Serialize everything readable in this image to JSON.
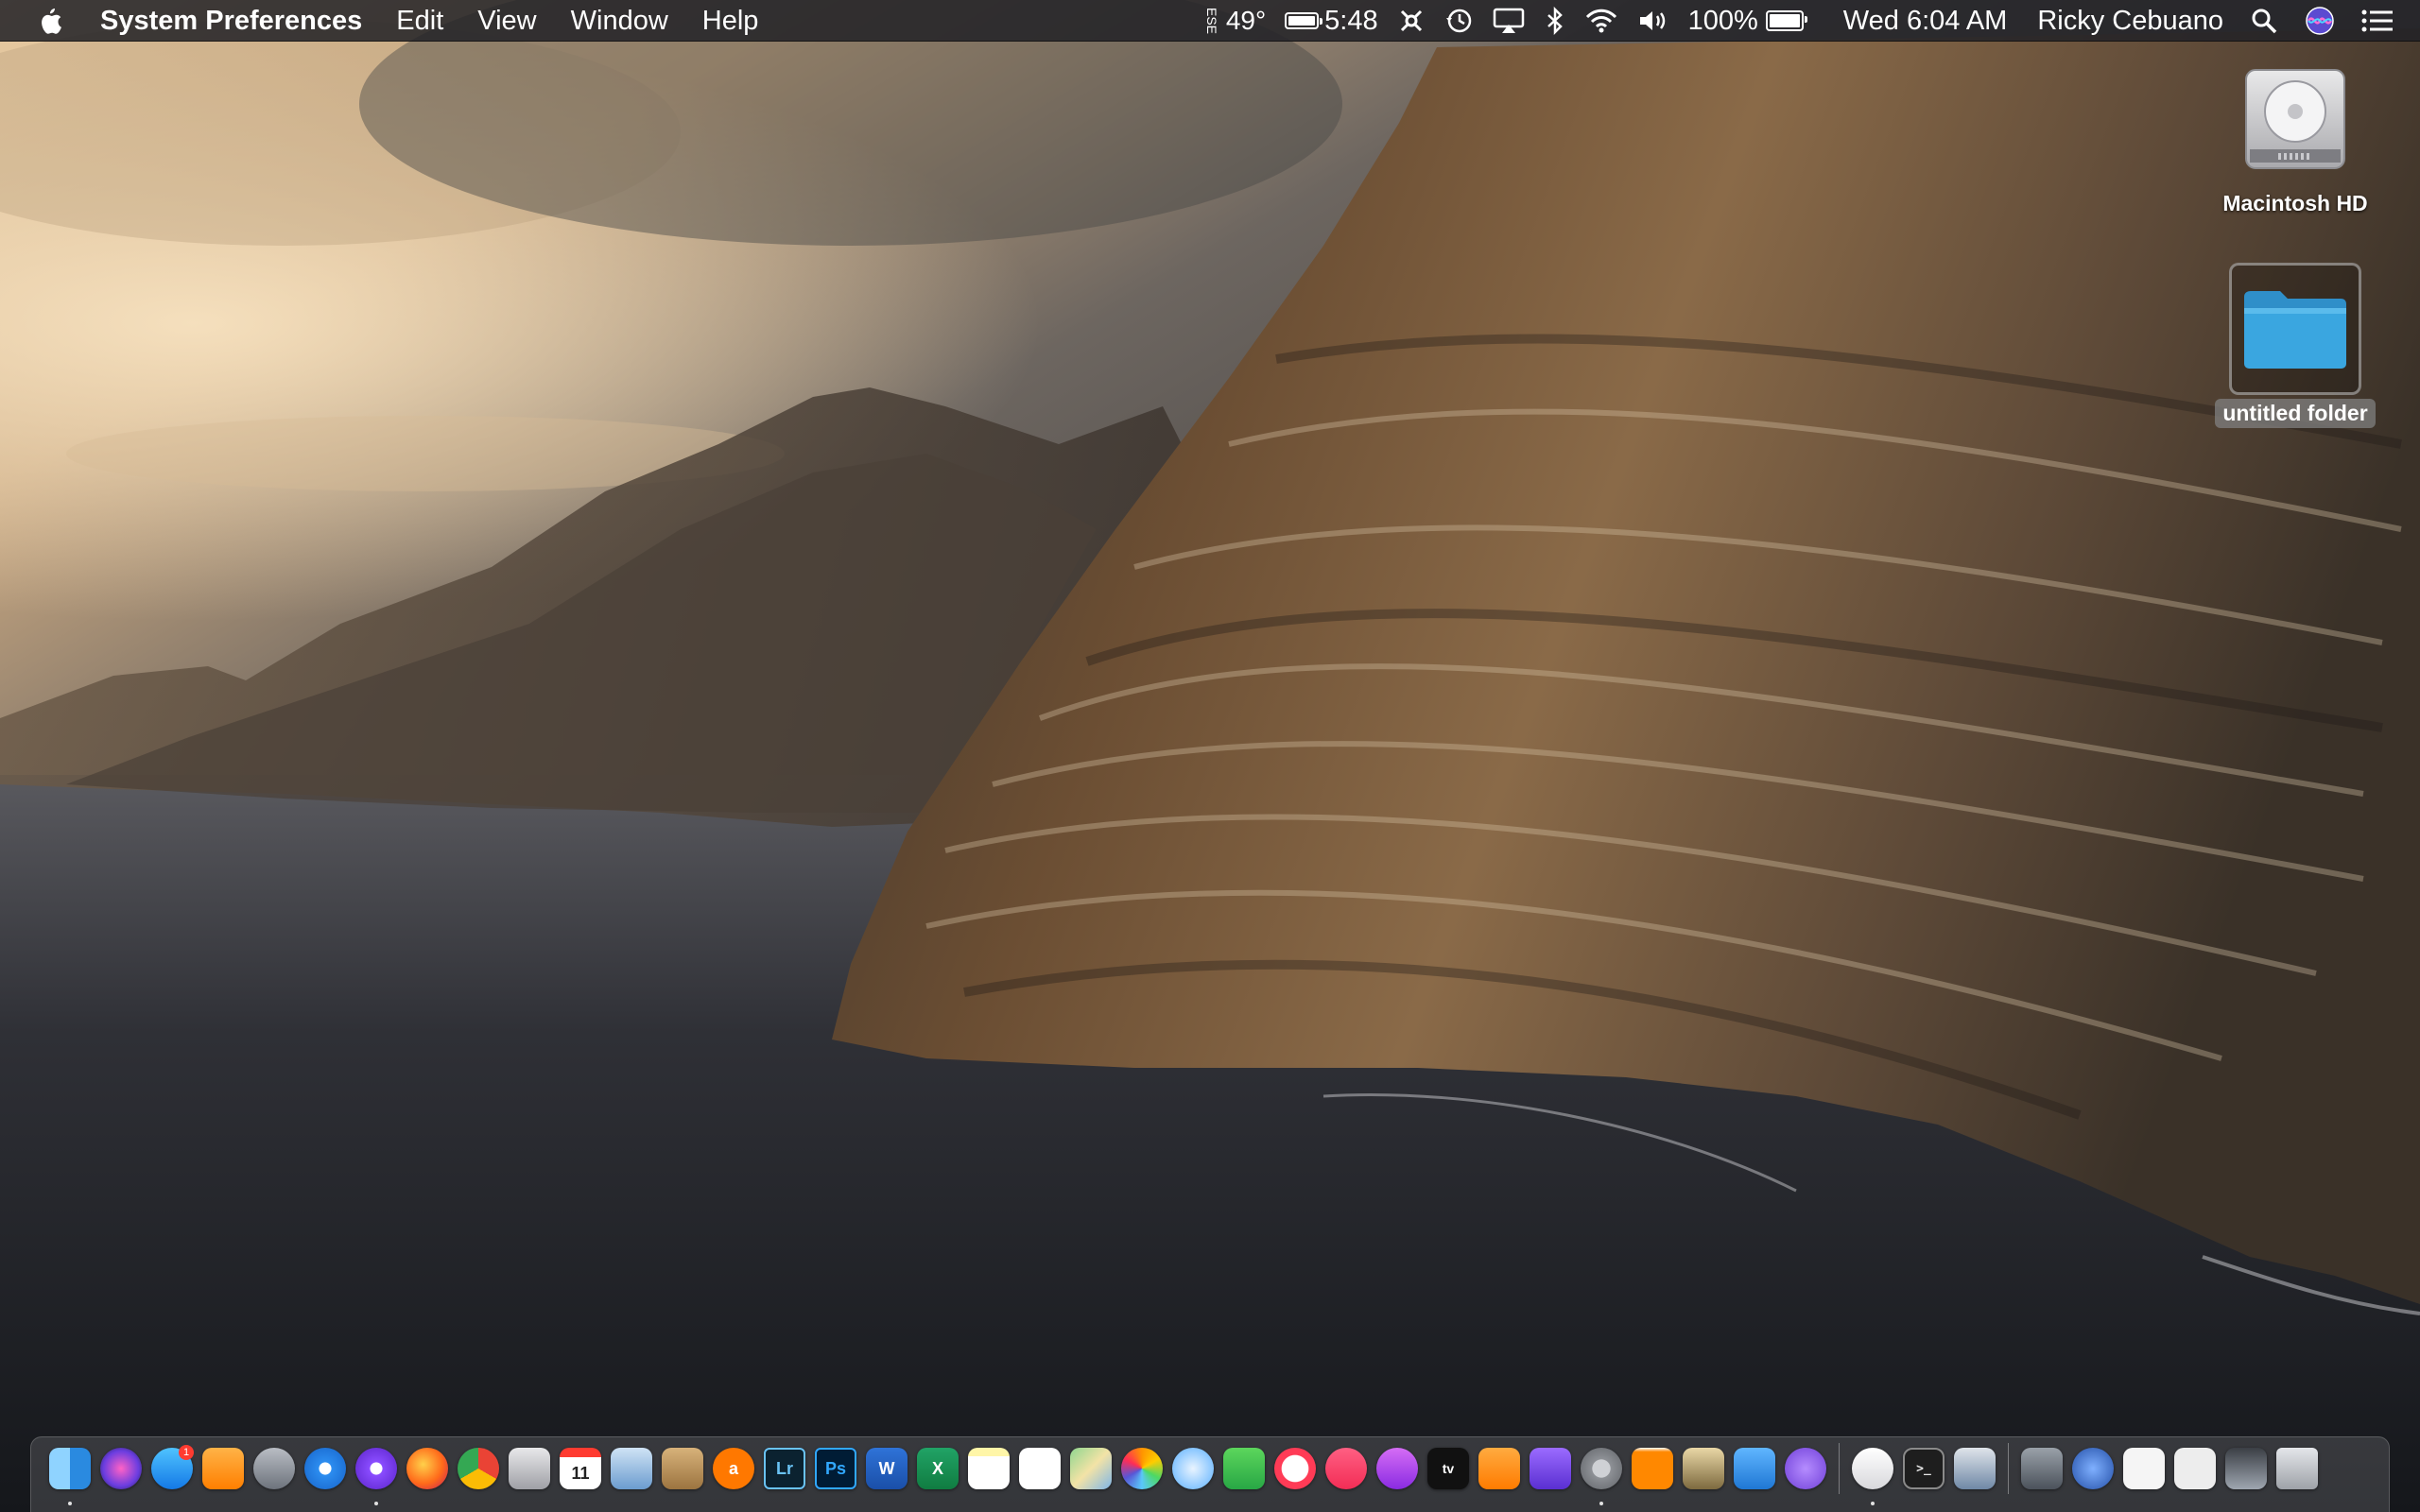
{
  "menubar": {
    "app_name": "System Preferences",
    "menus": [
      "Edit",
      "View",
      "Window",
      "Help"
    ],
    "status": {
      "weather_condition": "ESE",
      "temperature": "49°",
      "battery_time": "5:48",
      "battery_percent": "100%",
      "battery_level": 1.0,
      "clock": "Wed 6:04 AM",
      "user_name": "Ricky Cebuano"
    }
  },
  "desktop": {
    "icons": [
      {
        "label": "Macintosh HD",
        "icon": "hard-drive-icon",
        "selected": false
      },
      {
        "label": "untitled folder",
        "icon": "folder-icon",
        "selected": true
      }
    ]
  },
  "dock": {
    "items": [
      {
        "name": "finder",
        "icon": "finder-icon",
        "running": true
      },
      {
        "name": "siri",
        "icon": "siri-icon",
        "running": false
      },
      {
        "name": "app-store",
        "icon": "app-store-icon",
        "running": false,
        "badge": "1"
      },
      {
        "name": "home",
        "icon": "home-icon",
        "running": false
      },
      {
        "name": "launchpad",
        "icon": "rocket-icon",
        "running": false
      },
      {
        "name": "safari",
        "icon": "compass-icon",
        "running": false
      },
      {
        "name": "safari-preview",
        "icon": "compass-purple-icon",
        "running": true
      },
      {
        "name": "firefox",
        "icon": "firefox-icon",
        "running": false
      },
      {
        "name": "chrome",
        "icon": "chrome-icon",
        "running": false
      },
      {
        "name": "image-capture",
        "icon": "camera-icon",
        "running": false
      },
      {
        "name": "calendar",
        "icon": "calendar-icon",
        "running": false,
        "text": "11"
      },
      {
        "name": "preview",
        "icon": "preview-icon",
        "running": false
      },
      {
        "name": "notefile",
        "icon": "notebook-icon",
        "running": false
      },
      {
        "name": "avast",
        "icon": "avast-icon",
        "running": false,
        "text": "a"
      },
      {
        "name": "lightroom",
        "icon": "lightroom-icon",
        "running": false,
        "text": "Lr"
      },
      {
        "name": "photoshop",
        "icon": "photoshop-icon",
        "running": false,
        "text": "Ps"
      },
      {
        "name": "word",
        "icon": "word-icon",
        "running": false,
        "text": "W"
      },
      {
        "name": "excel",
        "icon": "excel-icon",
        "running": false,
        "text": "X"
      },
      {
        "name": "notes",
        "icon": "notes-icon",
        "running": false
      },
      {
        "name": "reminders",
        "icon": "reminders-icon",
        "running": false
      },
      {
        "name": "maps",
        "icon": "map-icon",
        "running": false
      },
      {
        "name": "photos",
        "icon": "photos-icon",
        "running": false
      },
      {
        "name": "messages",
        "icon": "message-bubble-icon",
        "running": false
      },
      {
        "name": "facetime",
        "icon": "video-camera-icon",
        "running": false
      },
      {
        "name": "news",
        "icon": "news-icon",
        "running": false
      },
      {
        "name": "music",
        "icon": "music-note-icon",
        "running": false
      },
      {
        "name": "podcasts",
        "icon": "podcast-icon",
        "running": false
      },
      {
        "name": "apple-tv",
        "icon": "tv-icon",
        "running": false,
        "text": "tv"
      },
      {
        "name": "books",
        "icon": "book-icon",
        "running": false
      },
      {
        "name": "imovie",
        "icon": "star-icon",
        "running": false
      },
      {
        "name": "system-preferences",
        "icon": "gear-icon",
        "running": true
      },
      {
        "name": "vlc",
        "icon": "traffic-cone-icon",
        "running": false
      },
      {
        "name": "preview-2",
        "icon": "photo-stack-icon",
        "running": false
      },
      {
        "name": "xcode",
        "icon": "hammer-icon",
        "running": false
      },
      {
        "name": "feedback",
        "icon": "exclamation-bubble-icon",
        "running": false
      },
      {
        "gap": true
      },
      {
        "name": "wireless-diagnostics",
        "icon": "wifi-icon",
        "running": true
      },
      {
        "name": "terminal",
        "icon": "terminal-icon",
        "running": false,
        "text": ">_"
      },
      {
        "name": "screenshot-stack",
        "icon": "screenshot-icon",
        "running": false
      },
      {
        "gap": true
      },
      {
        "name": "downloads-stack",
        "icon": "downloads-icon",
        "running": false
      },
      {
        "name": "documents-stack",
        "icon": "globe-icon",
        "running": false
      },
      {
        "name": "document-1",
        "icon": "document-icon",
        "running": false
      },
      {
        "name": "document-2",
        "icon": "document-wide-icon",
        "running": false
      },
      {
        "name": "document-3",
        "icon": "screenshot-file-icon",
        "running": false
      },
      {
        "name": "trash",
        "icon": "trash-icon",
        "running": false
      }
    ]
  },
  "colors": {
    "menubar_bg": "#222226",
    "folder_blue": "#3aa6e0",
    "accent_red": "#ff3b30"
  }
}
